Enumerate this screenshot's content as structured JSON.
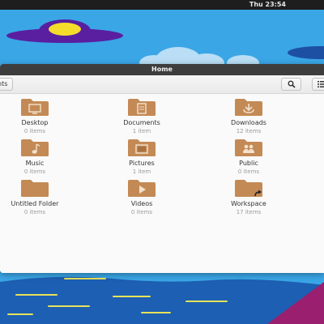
{
  "panel": {
    "clock": "Thu 23:54"
  },
  "window": {
    "title": "Home",
    "toolbar": {
      "recent_label": "nts",
      "search_icon": "search-icon",
      "view_icon": "view-options-icon"
    }
  },
  "items": [
    {
      "name": "Desktop",
      "count": "0 items",
      "icon": "desktop-folder-icon"
    },
    {
      "name": "Documents",
      "count": "1 item",
      "icon": "documents-folder-icon"
    },
    {
      "name": "Downloads",
      "count": "12 items",
      "icon": "downloads-folder-icon"
    },
    {
      "name": "Music",
      "count": "0 items",
      "icon": "music-folder-icon"
    },
    {
      "name": "Pictures",
      "count": "1 item",
      "icon": "pictures-folder-icon"
    },
    {
      "name": "Public",
      "count": "0 items",
      "icon": "public-folder-icon"
    },
    {
      "name": "Untitled Folder",
      "count": "0 items",
      "icon": "folder-icon"
    },
    {
      "name": "Videos",
      "count": "0 items",
      "icon": "videos-folder-icon"
    },
    {
      "name": "Workspace",
      "count": "17 items",
      "icon": "symlink-folder-icon"
    }
  ],
  "colors": {
    "folder": "#c48a55",
    "folder_dark": "#a8713f",
    "titlebar": "#3d3d3d",
    "wallpaper_sky": "#3aa6e6",
    "wallpaper_deep": "#1d5fb2",
    "wallpaper_magenta": "#9a1f6e"
  }
}
